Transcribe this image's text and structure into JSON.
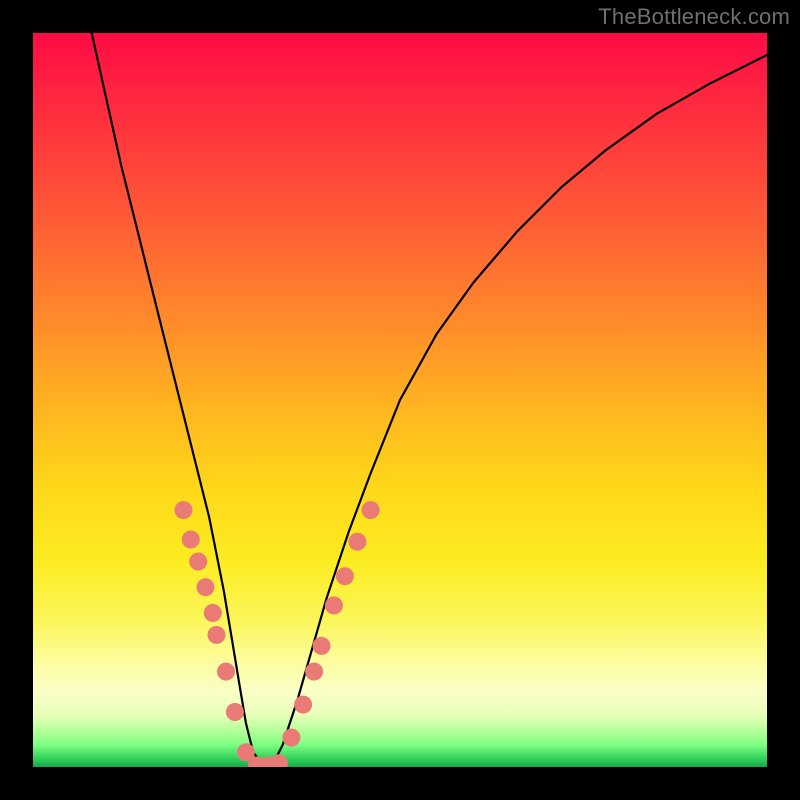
{
  "watermark": "TheBottleneck.com",
  "colors": {
    "dot_fill": "#e97a75",
    "curve_stroke": "#000000",
    "frame_bg": "#000000"
  },
  "chart_data": {
    "type": "line",
    "title": "",
    "xlabel": "",
    "ylabel": "",
    "xlim": [
      0,
      100
    ],
    "ylim": [
      0,
      100
    ],
    "grid": false,
    "series": [
      {
        "name": "curve",
        "x": [
          8,
          10,
          12,
          14,
          16,
          18,
          20,
          22,
          24,
          26,
          27,
          28,
          29,
          30,
          31.5,
          32.5,
          34,
          36,
          38,
          40,
          43,
          46,
          50,
          55,
          60,
          66,
          72,
          78,
          85,
          92,
          100
        ],
        "y": [
          100,
          91,
          82,
          74,
          66,
          58,
          50,
          42,
          34,
          24,
          18,
          12,
          6,
          2,
          0,
          0,
          3,
          9,
          16,
          23,
          32,
          40,
          50,
          59,
          66,
          73,
          79,
          84,
          89,
          93,
          97
        ]
      }
    ],
    "markers": {
      "name": "data-points",
      "points": [
        {
          "x": 20.5,
          "y": 35.0
        },
        {
          "x": 21.5,
          "y": 31.0
        },
        {
          "x": 22.5,
          "y": 28.0
        },
        {
          "x": 23.5,
          "y": 24.5
        },
        {
          "x": 24.5,
          "y": 21.0
        },
        {
          "x": 25.0,
          "y": 18.0
        },
        {
          "x": 26.3,
          "y": 13.0
        },
        {
          "x": 27.5,
          "y": 7.5
        },
        {
          "x": 29.0,
          "y": 2.0
        },
        {
          "x": 30.5,
          "y": 0.2
        },
        {
          "x": 32.0,
          "y": 0.2
        },
        {
          "x": 33.5,
          "y": 0.5
        },
        {
          "x": 35.2,
          "y": 4.0
        },
        {
          "x": 36.8,
          "y": 8.5
        },
        {
          "x": 38.3,
          "y": 13.0
        },
        {
          "x": 39.3,
          "y": 16.5
        },
        {
          "x": 41.0,
          "y": 22.0
        },
        {
          "x": 42.5,
          "y": 26.0
        },
        {
          "x": 44.2,
          "y": 30.7
        },
        {
          "x": 46.0,
          "y": 35.0
        }
      ]
    }
  }
}
